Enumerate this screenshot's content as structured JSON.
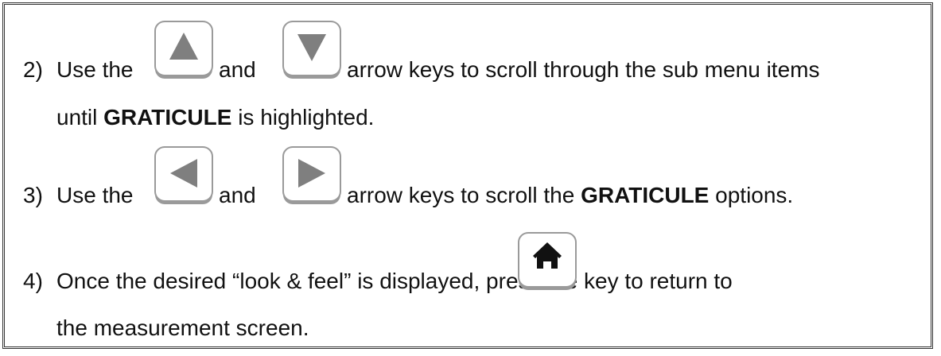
{
  "steps": [
    {
      "number": "2)",
      "text_use_the": "Use the",
      "key_a_icon": "up-arrow-icon",
      "text_and": "and",
      "key_b_icon": "down-arrow-icon",
      "text_after": "arrow keys to scroll through the sub menu items",
      "cont_before": "until",
      "cont_bold": "GRATICULE",
      "cont_after": "is highlighted."
    },
    {
      "number": "3)",
      "text_use_the": "Use the",
      "key_a_icon": "left-arrow-icon",
      "text_and": "and",
      "key_b_icon": "right-arrow-icon",
      "text_after_before": "arrow keys to scroll the",
      "text_bold": "GRATICULE",
      "text_after_end": "options."
    },
    {
      "number": "4)",
      "text_before": "Once the desired “look & feel” is displayed, press the",
      "key_icon": "home-icon",
      "text_after": "key to return to",
      "cont": "the measurement screen."
    }
  ],
  "colors": {
    "key_border": "#9a9a9a",
    "key_glyph": "#7f7f7f",
    "home_glyph": "#111111",
    "frame": "#333333"
  }
}
